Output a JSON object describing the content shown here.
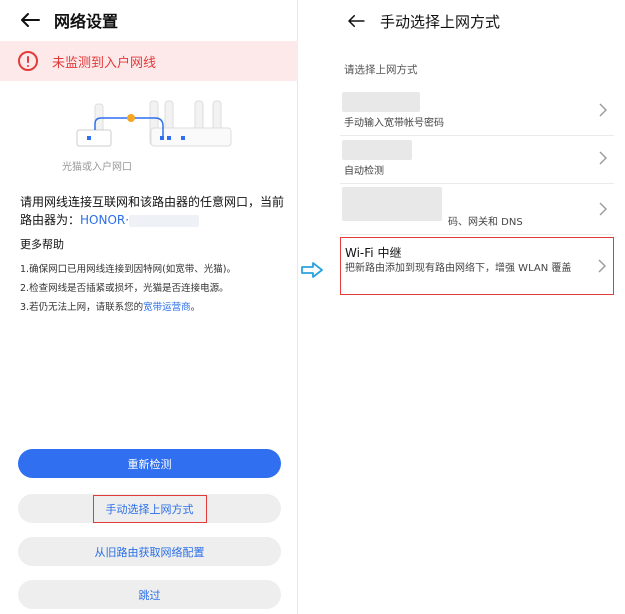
{
  "left": {
    "title": "网络设置",
    "alert": "未监测到入户网线",
    "diagram_caption": "光猫或入户网口",
    "desc_prefix": "请用网线连接互联网和该路由器的任意网口，当前路由器为：",
    "router_name": "HONOR·",
    "help_title": "更多帮助",
    "help_items": [
      "1.确保网口已用网线连接到因特网(如宽带、光猫)。",
      "2.检查网线是否插紧或损坏，光猫是否连接电源。",
      "3.若仍无法上网，请联系您的"
    ],
    "help_link": "宽带运营商",
    "help_suffix": "。",
    "buttons": {
      "recheck": "重新检测",
      "manual": "手动选择上网方式",
      "from_old": "从旧路由获取网络配置",
      "skip": "跳过"
    }
  },
  "right": {
    "title": "手动选择上网方式",
    "subtitle": "请选择上网方式",
    "items": [
      {
        "label": "手动输入宽带帐号密码"
      },
      {
        "label": "自动检测"
      },
      {
        "label": "码、网关和 DNS"
      },
      {
        "title": "Wi-Fi 中继",
        "label": "把新路由添加到现有路由网络下，增强 WLAN 覆盖"
      }
    ]
  },
  "colors": {
    "accent": "#2f6ff0",
    "alert": "#e33a3a",
    "alert_bg": "#fde9ea"
  }
}
